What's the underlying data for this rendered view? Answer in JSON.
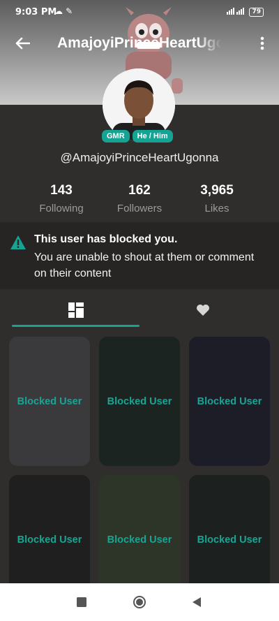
{
  "status_bar": {
    "time": "9:03 PM",
    "battery": "79"
  },
  "header": {
    "title": "AmajoyiPrinceHeartUgonna"
  },
  "profile": {
    "badges": [
      "GMR",
      "He / Him"
    ],
    "handle": "@AmajoyiPrinceHeartUgonna"
  },
  "stats": [
    {
      "value": "143",
      "label": "Following"
    },
    {
      "value": "162",
      "label": "Followers"
    },
    {
      "value": "3,965",
      "label": "Likes"
    }
  ],
  "blocked_notice": {
    "heading": "This user has blocked you.",
    "message": "You are unable to shout at them or comment on their content"
  },
  "tabs": [
    {
      "icon": "grid-icon",
      "active": true
    },
    {
      "icon": "heart-icon",
      "active": false
    }
  ],
  "tiles": [
    {
      "label": "Blocked User",
      "color": "#3a3a3d"
    },
    {
      "label": "Blocked User",
      "color": "#1c2421"
    },
    {
      "label": "Blocked User",
      "color": "#1c1d26"
    },
    {
      "label": "Blocked User",
      "color": "#1f1f1f"
    },
    {
      "label": "Blocked User",
      "color": "#2c3527"
    },
    {
      "label": "Blocked User",
      "color": "#1c211f"
    }
  ],
  "colors": {
    "accent": "#15a394",
    "background": "#2f2e2c"
  },
  "nav": [
    "recents-icon",
    "home-icon",
    "back-triangle-icon"
  ]
}
